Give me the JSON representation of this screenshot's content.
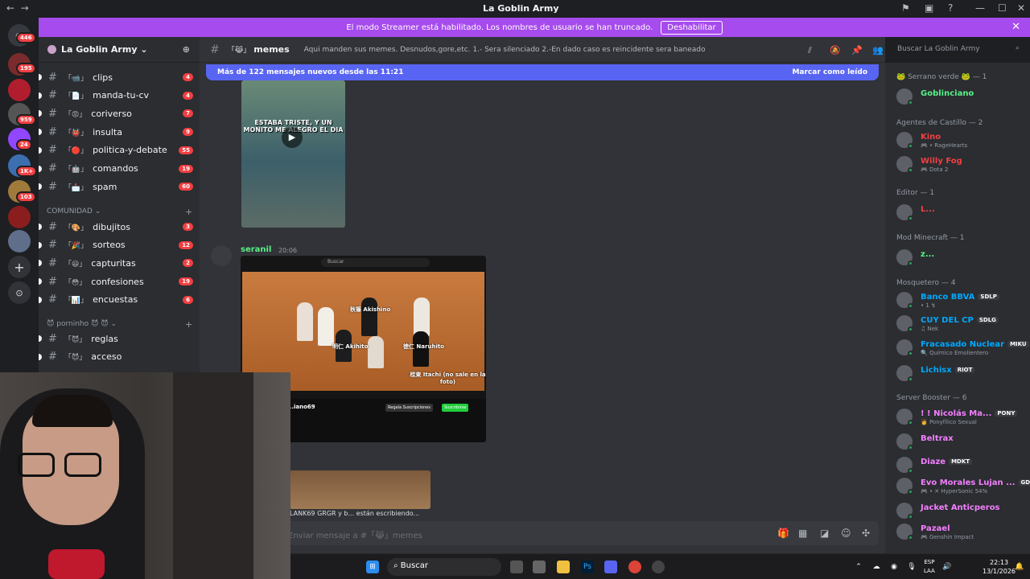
{
  "window": {
    "title": "La Goblin Army"
  },
  "banner": {
    "text": "El modo Streamer está habilitado. Los nombres de usuario se han truncado.",
    "button": "Deshabilitar"
  },
  "guild_badges": [
    "446",
    "195",
    "959",
    "24",
    "1K+",
    "103"
  ],
  "server": {
    "name": "La Goblin Army"
  },
  "channels_top": [
    {
      "emoji": "「📹」",
      "name": "clips",
      "badge": "4"
    },
    {
      "emoji": "「📄」",
      "name": "manda-tu-cv",
      "badge": "4"
    },
    {
      "emoji": "「😡」",
      "name": "coriverso",
      "badge": "7"
    },
    {
      "emoji": "「👹」",
      "name": "insulta",
      "badge": "9"
    },
    {
      "emoji": "「🔴」",
      "name": "politica-y-debate",
      "badge": "55"
    },
    {
      "emoji": "「🤖」",
      "name": "comandos",
      "badge": "19"
    },
    {
      "emoji": "「📩」",
      "name": "spam",
      "badge": "60"
    }
  ],
  "category_comunidad": "COMUNIDAD",
  "channels_comunidad": [
    {
      "emoji": "「🎨」",
      "name": "dibujitos",
      "badge": "3"
    },
    {
      "emoji": "「🎉」",
      "name": "sorteos",
      "badge": "12"
    },
    {
      "emoji": "「😃」",
      "name": "capturitas",
      "badge": "2"
    },
    {
      "emoji": "「😳」",
      "name": "confesiones",
      "badge": "19"
    },
    {
      "emoji": "「📊」",
      "name": "encuestas",
      "badge": "6"
    }
  ],
  "category_porn": "😈 porninho 😈 😈",
  "channels_porn": [
    {
      "emoji": "「😈」",
      "name": "reglas"
    },
    {
      "emoji": "「😈」",
      "name": "acceso"
    }
  ],
  "header": {
    "emoji": "「😹」",
    "channel": "memes",
    "topic": "Aqui manden sus memes. Desnudos,gore,etc. 1.- Sera silenciado 2.-En dado caso es reincidente sera baneado",
    "search": "Buscar La Goblin Army"
  },
  "new_messages": {
    "text": "Más de 122 mensajes nuevos desde las 11:21",
    "action": "Marcar como leído"
  },
  "video": {
    "caption": "ESTABA TRISTE, Y UN MONITO ME ALEGRO EL DIA"
  },
  "message": {
    "author": "seranil",
    "time": "20:06"
  },
  "embed": {
    "search": "Buscar",
    "labels": [
      "秋篠 Akishino",
      "明仁 Akihito",
      "徳仁 Naruhito",
      "桂東 Itachi (no sale en la foto)"
    ],
    "channel": "...iano69",
    "sub": "Regala Suscripciones",
    "subscribe": "Suscribirse"
  },
  "typing": "LANK69 GRGR y b... están escribiendo...",
  "composer": {
    "placeholder": "Enviar mensaje a #「😹」memes"
  },
  "members": {
    "groups": [
      {
        "title": "🐸 Serrano verde 🐸 — 1",
        "members": [
          {
            "name": "Goblinciano",
            "color": "#57f287",
            "sub": "",
            "tag": ""
          }
        ]
      },
      {
        "title": "Agentes de Castillo — 2",
        "members": [
          {
            "name": "Kino",
            "color": "#f23f42",
            "sub": "🎮 • RageHearts",
            "tag": ""
          },
          {
            "name": "Willy Fog",
            "color": "#f23f42",
            "sub": "🎮 Dota 2",
            "tag": ""
          }
        ]
      },
      {
        "title": "Editor — 1",
        "members": [
          {
            "name": "L...",
            "color": "#f23f42",
            "sub": "",
            "tag": ""
          }
        ]
      },
      {
        "title": "Mod Minecraft — 1",
        "members": [
          {
            "name": "z...",
            "color": "#57f287",
            "sub": "",
            "tag": ""
          }
        ]
      },
      {
        "title": "Mosquetero — 4",
        "members": [
          {
            "name": "Banco BBVA",
            "color": "#00a8fc",
            "sub": "• 1 ↯",
            "tag": "SDLP"
          },
          {
            "name": "CUY DEL CP",
            "color": "#00a8fc",
            "sub": "♫ Nek",
            "tag": "SDLG"
          },
          {
            "name": "Fracasado Nuclear",
            "color": "#00a8fc",
            "sub": "🔍 Químico Emolientero",
            "tag": "MIKU"
          },
          {
            "name": "Lichisx",
            "color": "#00a8fc",
            "sub": "",
            "tag": "RIOT"
          }
        ]
      },
      {
        "title": "Server Booster — 6",
        "members": [
          {
            "name": "! ! Nicolás Ma...",
            "color": "#f47fff",
            "sub": "👩 Ponyfílico Sexual",
            "tag": "PONY"
          },
          {
            "name": "Beltrax",
            "color": "#f47fff",
            "sub": "",
            "tag": ""
          },
          {
            "name": "Diaze",
            "color": "#f47fff",
            "sub": "",
            "tag": "MDKT"
          },
          {
            "name": "Evo Morales Lujan ...",
            "color": "#f47fff",
            "sub": "🎮 • ✕ HyperSonic 54%",
            "tag": "GD"
          },
          {
            "name": "Jacket Anticperos",
            "color": "#f47fff",
            "sub": "",
            "tag": ""
          },
          {
            "name": "Pazael",
            "color": "#f47fff",
            "sub": "🎮 Genshin Impact",
            "tag": ""
          }
        ]
      }
    ]
  },
  "taskbar": {
    "search": "Buscar",
    "lang1": "ESP",
    "lang2": "LAA",
    "time": "22:13",
    "date": "13/1/2026"
  }
}
